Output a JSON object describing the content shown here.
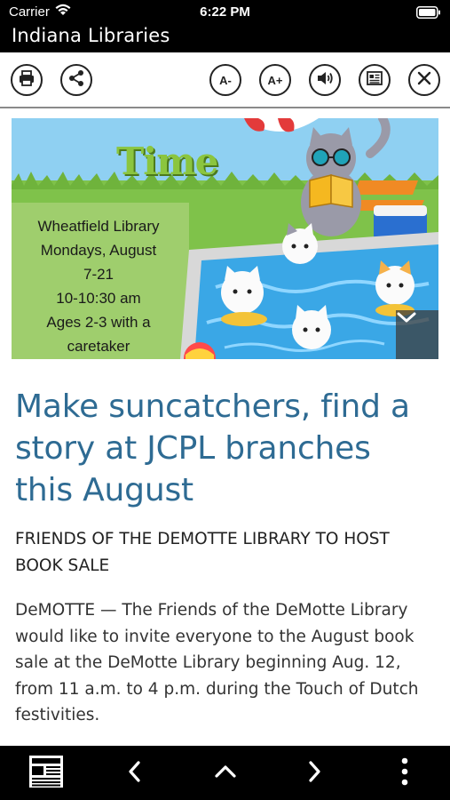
{
  "status_bar": {
    "carrier": "Carrier",
    "time": "6:22 PM"
  },
  "app": {
    "title": "Indiana Libraries"
  },
  "toolbar": {
    "print_icon": "printer-icon",
    "share_icon": "share-icon",
    "font_decrease_label": "A-",
    "font_increase_label": "A+",
    "audio_icon": "speaker-icon",
    "reader_icon": "article-icon",
    "close_icon": "close-icon"
  },
  "hero": {
    "poster_title": "Time",
    "poster_lines": [
      "Wheatfield Library",
      "Mondays, August",
      "7-21",
      "10-10:30 am",
      "Ages 2-3 with a",
      "caretaker"
    ],
    "expand_icon": "chevron-down-icon"
  },
  "article": {
    "headline": "Make suncatchers, find a story at JCPL branches this August",
    "subhead": "FRIENDS OF THE DEMOTTE LIBRARY TO HOST BOOK SALE",
    "body": "DeMOTTE — The Friends of the DeMotte Library would like to invite everyone to the August book sale at the DeMotte Library beginning Aug. 12, from 11 a.m. to 4 p.m. during the Touch of Dutch festivities."
  },
  "bottom_bar": {
    "edition_icon": "newspaper-icon",
    "prev_icon": "chevron-left-icon",
    "up_icon": "chevron-up-icon",
    "next_icon": "chevron-right-icon",
    "more_icon": "more-vertical-icon"
  },
  "colors": {
    "headline": "#2e6b93",
    "bar_background": "#000000",
    "poster_title": "#8bc53f"
  }
}
